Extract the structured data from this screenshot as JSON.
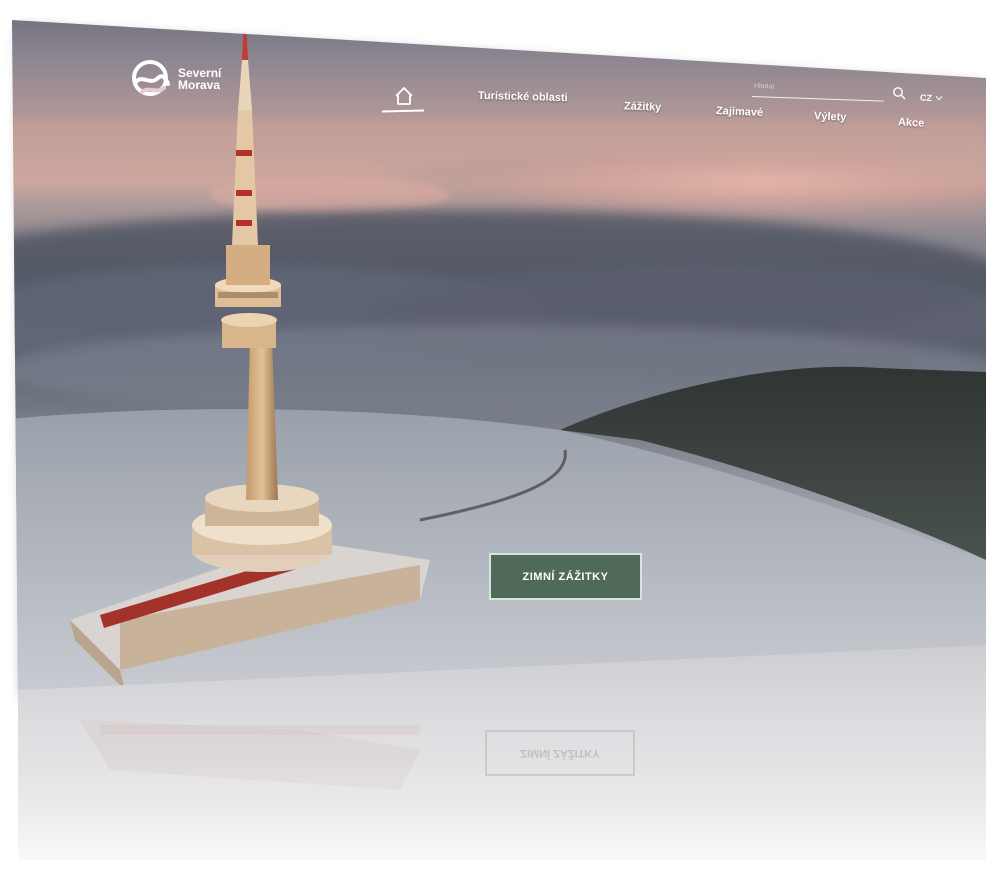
{
  "brand": {
    "name_line1": "Severní",
    "name_line2": "Morava"
  },
  "nav": {
    "home_icon": "home-icon",
    "items": [
      {
        "label": "Turistické oblasti"
      },
      {
        "label": "Zážitky"
      },
      {
        "label": "Zajímavé"
      },
      {
        "label": "Výlety"
      },
      {
        "label": "Akce"
      }
    ]
  },
  "search": {
    "placeholder": "Hledat",
    "icon": "search-icon"
  },
  "language": {
    "selected": "CZ",
    "icon": "chevron-down-icon"
  },
  "hero": {
    "cta_label": "ZIMNÍ ZÁŽITKY",
    "cta_color": "#4f6a58"
  },
  "reflection": {
    "cta_label": "ZIMNÍ ZÁŽITKY"
  }
}
